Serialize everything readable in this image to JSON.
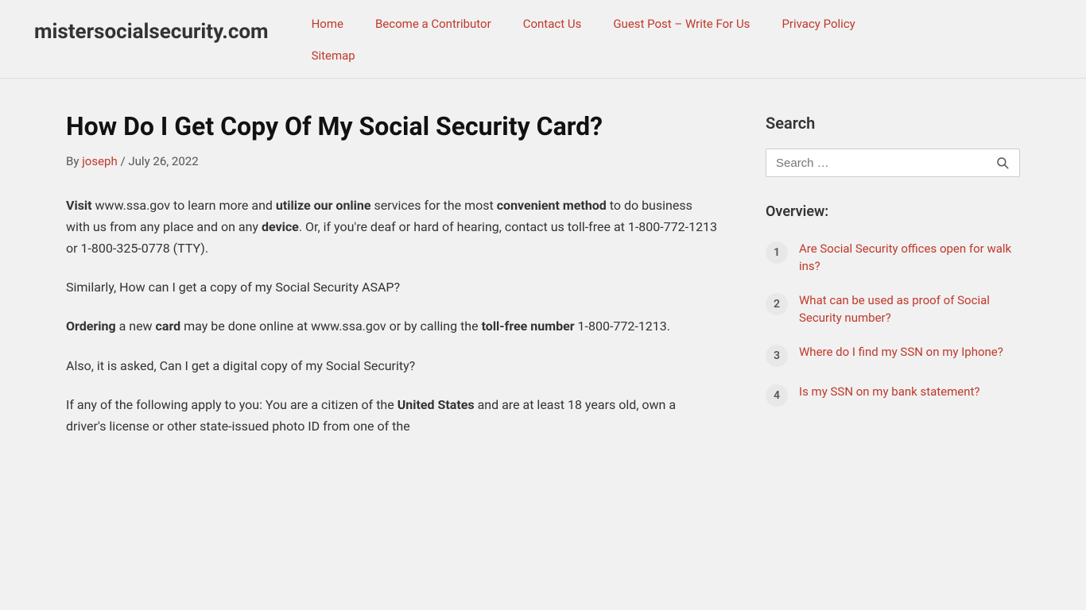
{
  "site": {
    "logo": "mistersocialsecurity.com",
    "logo_url": "#"
  },
  "nav": {
    "top_links": [
      {
        "label": "Home",
        "url": "#"
      },
      {
        "label": "Become a Contributor",
        "url": "#"
      },
      {
        "label": "Contact Us",
        "url": "#"
      },
      {
        "label": "Guest Post – Write For Us",
        "url": "#"
      },
      {
        "label": "Privacy Policy",
        "url": "#"
      }
    ],
    "bottom_links": [
      {
        "label": "Sitemap",
        "url": "#"
      }
    ]
  },
  "article": {
    "title": "How Do I Get Copy Of My Social Security Card?",
    "meta_by": "By",
    "meta_author": "joseph",
    "meta_date": "July 26, 2022",
    "paragraphs": [
      {
        "id": "p1",
        "text_parts": [
          {
            "type": "bold",
            "text": "Visit"
          },
          {
            "type": "normal",
            "text": " www.ssa.gov to learn more and "
          },
          {
            "type": "bold",
            "text": "utilize our online"
          },
          {
            "type": "normal",
            "text": " services for the most "
          },
          {
            "type": "bold",
            "text": "convenient method"
          },
          {
            "type": "normal",
            "text": " to do business with us from any place and on any "
          },
          {
            "type": "bold",
            "text": "device"
          },
          {
            "type": "normal",
            "text": ". Or, if you're deaf or hard of hearing, contact us toll-free at 1-800-772-1213 or 1-800-325-0778 (TTY)."
          }
        ]
      },
      {
        "id": "p2",
        "text_parts": [
          {
            "type": "normal",
            "text": "Similarly, How can I get a copy of my Social Security ASAP?"
          }
        ]
      },
      {
        "id": "p3",
        "text_parts": [
          {
            "type": "bold",
            "text": "Ordering"
          },
          {
            "type": "normal",
            "text": " a new "
          },
          {
            "type": "bold",
            "text": "card"
          },
          {
            "type": "normal",
            "text": " may be done online at www.ssa.gov or by calling the "
          },
          {
            "type": "bold",
            "text": "toll-free number"
          },
          {
            "type": "normal",
            "text": " 1-800-772-1213."
          }
        ]
      },
      {
        "id": "p4",
        "text_parts": [
          {
            "type": "normal",
            "text": "Also, it is asked, Can I get a digital copy of my Social Security?"
          }
        ]
      },
      {
        "id": "p5",
        "text_parts": [
          {
            "type": "normal",
            "text": "If any of the following apply to you: You are a citizen of the "
          },
          {
            "type": "bold",
            "text": "United States"
          },
          {
            "type": "normal",
            "text": " and are at least 18 years old, own a driver's license or other state-issued photo ID from one of the"
          }
        ]
      }
    ]
  },
  "sidebar": {
    "search_title": "Search",
    "search_placeholder": "Search …",
    "search_button_label": "Search",
    "overview_title": "Overview:",
    "overview_items": [
      {
        "number": "1",
        "label": "Are Social Security offices open for walk ins?",
        "url": "#"
      },
      {
        "number": "2",
        "label": "What can be used as proof of Social Security number?",
        "url": "#"
      },
      {
        "number": "3",
        "label": "Where do I find my SSN on my Iphone?",
        "url": "#"
      },
      {
        "number": "4",
        "label": "Is my SSN on my bank statement?",
        "url": "#"
      }
    ]
  },
  "colors": {
    "accent": "#c0392b",
    "bg": "#f1f1f1"
  }
}
